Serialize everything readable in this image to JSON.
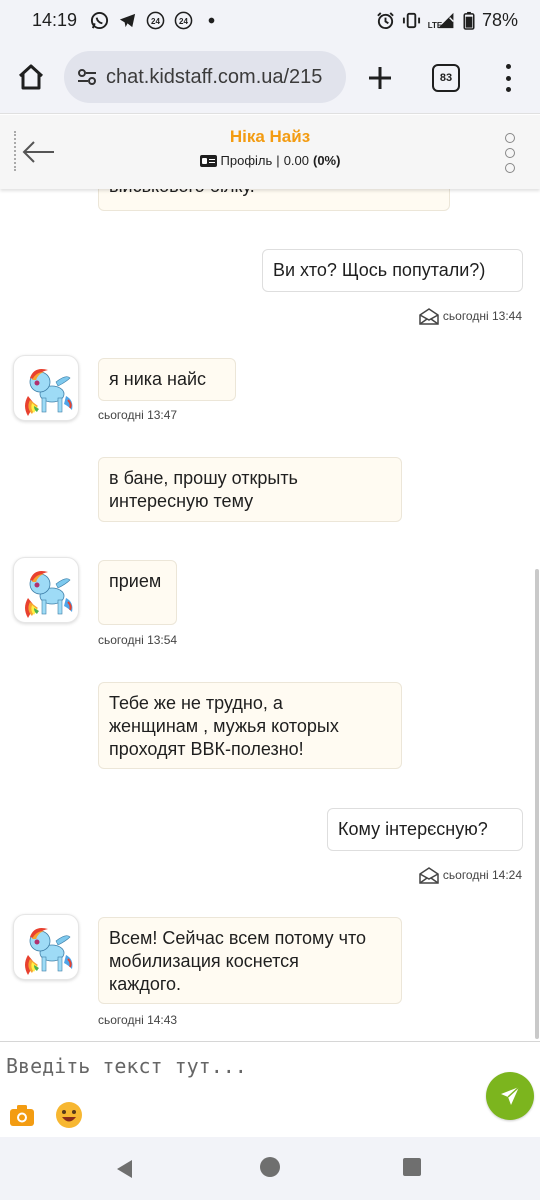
{
  "status_bar": {
    "time": "14:19",
    "notification_icons": [
      "whatsapp-icon",
      "telegram-icon",
      "24-icon",
      "24-icon",
      "dot-icon"
    ],
    "badge_24": "24",
    "network": "LTE",
    "battery": "78%"
  },
  "browser": {
    "url": "chat.kidstaff.com.ua/215",
    "tab_count": "83"
  },
  "chat": {
    "name": "Ніка Найз",
    "profile_label": "Профіль",
    "rating": "0.00",
    "rating_percent": "(0%)"
  },
  "messages": [
    {
      "text": "військового білку.",
      "direction": "in"
    },
    {
      "text": "Ви хто? Щось попутали?)",
      "direction": "out",
      "time": "сьогодні 13:44"
    },
    {
      "text": "я ника найс",
      "direction": "in",
      "time": "сьогодні 13:47"
    },
    {
      "text": "в бане, прошу открыть\nинтересную тему",
      "direction": "in"
    },
    {
      "text": "прием",
      "direction": "in",
      "time": "сьогодні 13:54"
    },
    {
      "text": "Тебе же не трудно, а\nженщинам , мужья которых\nпроходят ВВК-полезно!",
      "direction": "in"
    },
    {
      "text": "Кому інтерєсную?",
      "direction": "out",
      "time": "сьогодні 14:24"
    },
    {
      "text": "Всем! Сейчас всем потому что\nмобилизация коснется\nкаждого.",
      "direction": "in",
      "time": "сьогодні 14:43"
    }
  ],
  "composer": {
    "placeholder": "Введіть текст тут..."
  },
  "colors": {
    "accent_name": "#f39c12",
    "send_button": "#7cb51e",
    "bubble_in": "#fffbf2",
    "camera_icon": "#f39c12"
  }
}
